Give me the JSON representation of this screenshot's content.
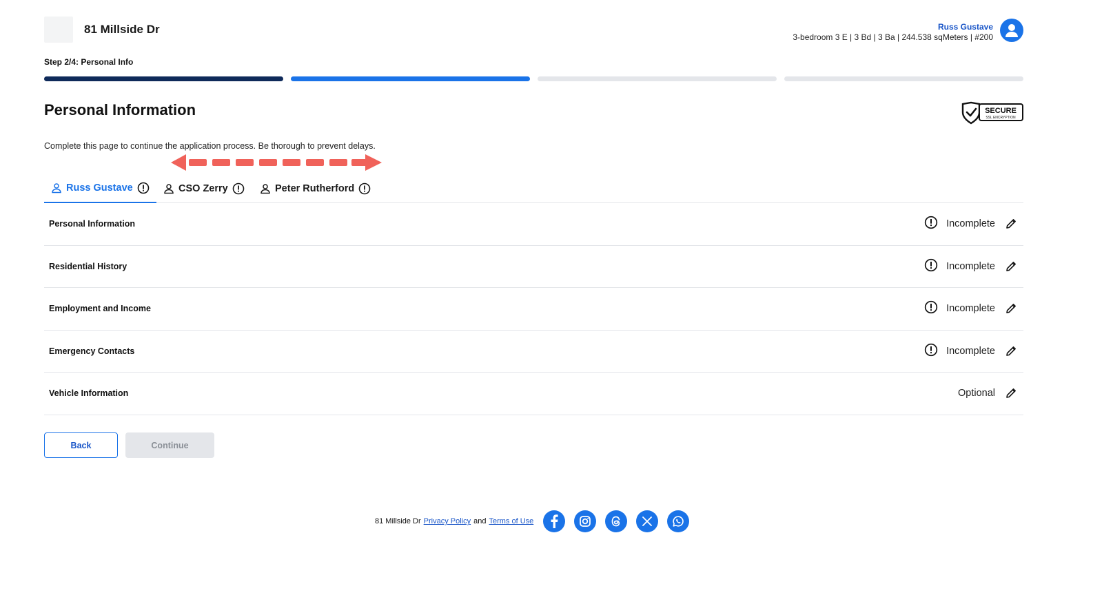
{
  "header": {
    "property_name": "81 Millside Dr",
    "user_name": "Russ Gustave",
    "unit_details": "3-bedroom 3 E | 3 Bd | 3 Ba | 244.538 sqMeters | #200"
  },
  "progress": {
    "step_label": "Step 2/4: Personal Info",
    "current_step": 2,
    "total_steps": 4
  },
  "page": {
    "title": "Personal Information",
    "subtitle": "Complete this page to continue the application process. Be thorough to prevent delays.",
    "secure_badge": {
      "line1": "SECURE",
      "line2": "SSL ENCRYPTION"
    }
  },
  "tabs": [
    {
      "label": "Russ Gustave",
      "active": true
    },
    {
      "label": "CSO Zerry",
      "active": false
    },
    {
      "label": "Peter Rutherford",
      "active": false
    }
  ],
  "sections": [
    {
      "title": "Personal Information",
      "status": "Incomplete",
      "warning": true
    },
    {
      "title": "Residential History",
      "status": "Incomplete",
      "warning": true
    },
    {
      "title": "Employment and Income",
      "status": "Incomplete",
      "warning": true
    },
    {
      "title": "Emergency Contacts",
      "status": "Incomplete",
      "warning": true
    },
    {
      "title": "Vehicle Information",
      "status": "Optional",
      "warning": false
    }
  ],
  "buttons": {
    "back": "Back",
    "continue": "Continue"
  },
  "footer": {
    "property_name": "81 Millside Dr",
    "privacy_link": "Privacy Policy",
    "and_text": "and",
    "terms_link": "Terms of Use",
    "social": [
      "facebook-icon",
      "instagram-icon",
      "threads-icon",
      "x-icon",
      "whatsapp-icon"
    ]
  },
  "colors": {
    "accent": "#1a73e8",
    "dark_progress": "#0f2a5a",
    "annotation_arrow": "#f0625a"
  }
}
